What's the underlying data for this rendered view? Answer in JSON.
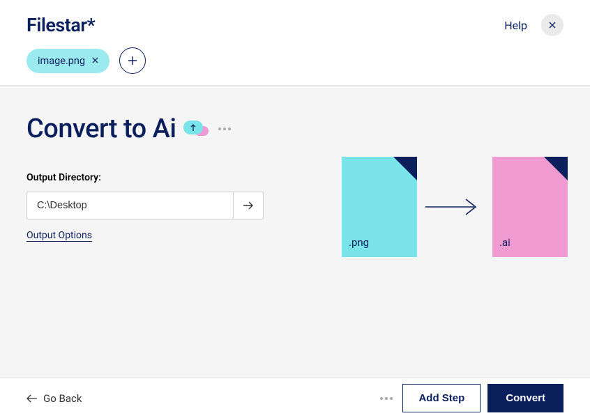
{
  "logo": "Filestar*",
  "header": {
    "help": "Help"
  },
  "file": {
    "name": "image.png"
  },
  "title": "Convert to Ai",
  "output": {
    "label": "Output Directory:",
    "path": "C:\\Desktop",
    "options_label": "Output Options"
  },
  "diagram": {
    "from_ext": ".png",
    "to_ext": ".ai"
  },
  "footer": {
    "back": "Go Back",
    "add_step": "Add Step",
    "convert": "Convert"
  }
}
